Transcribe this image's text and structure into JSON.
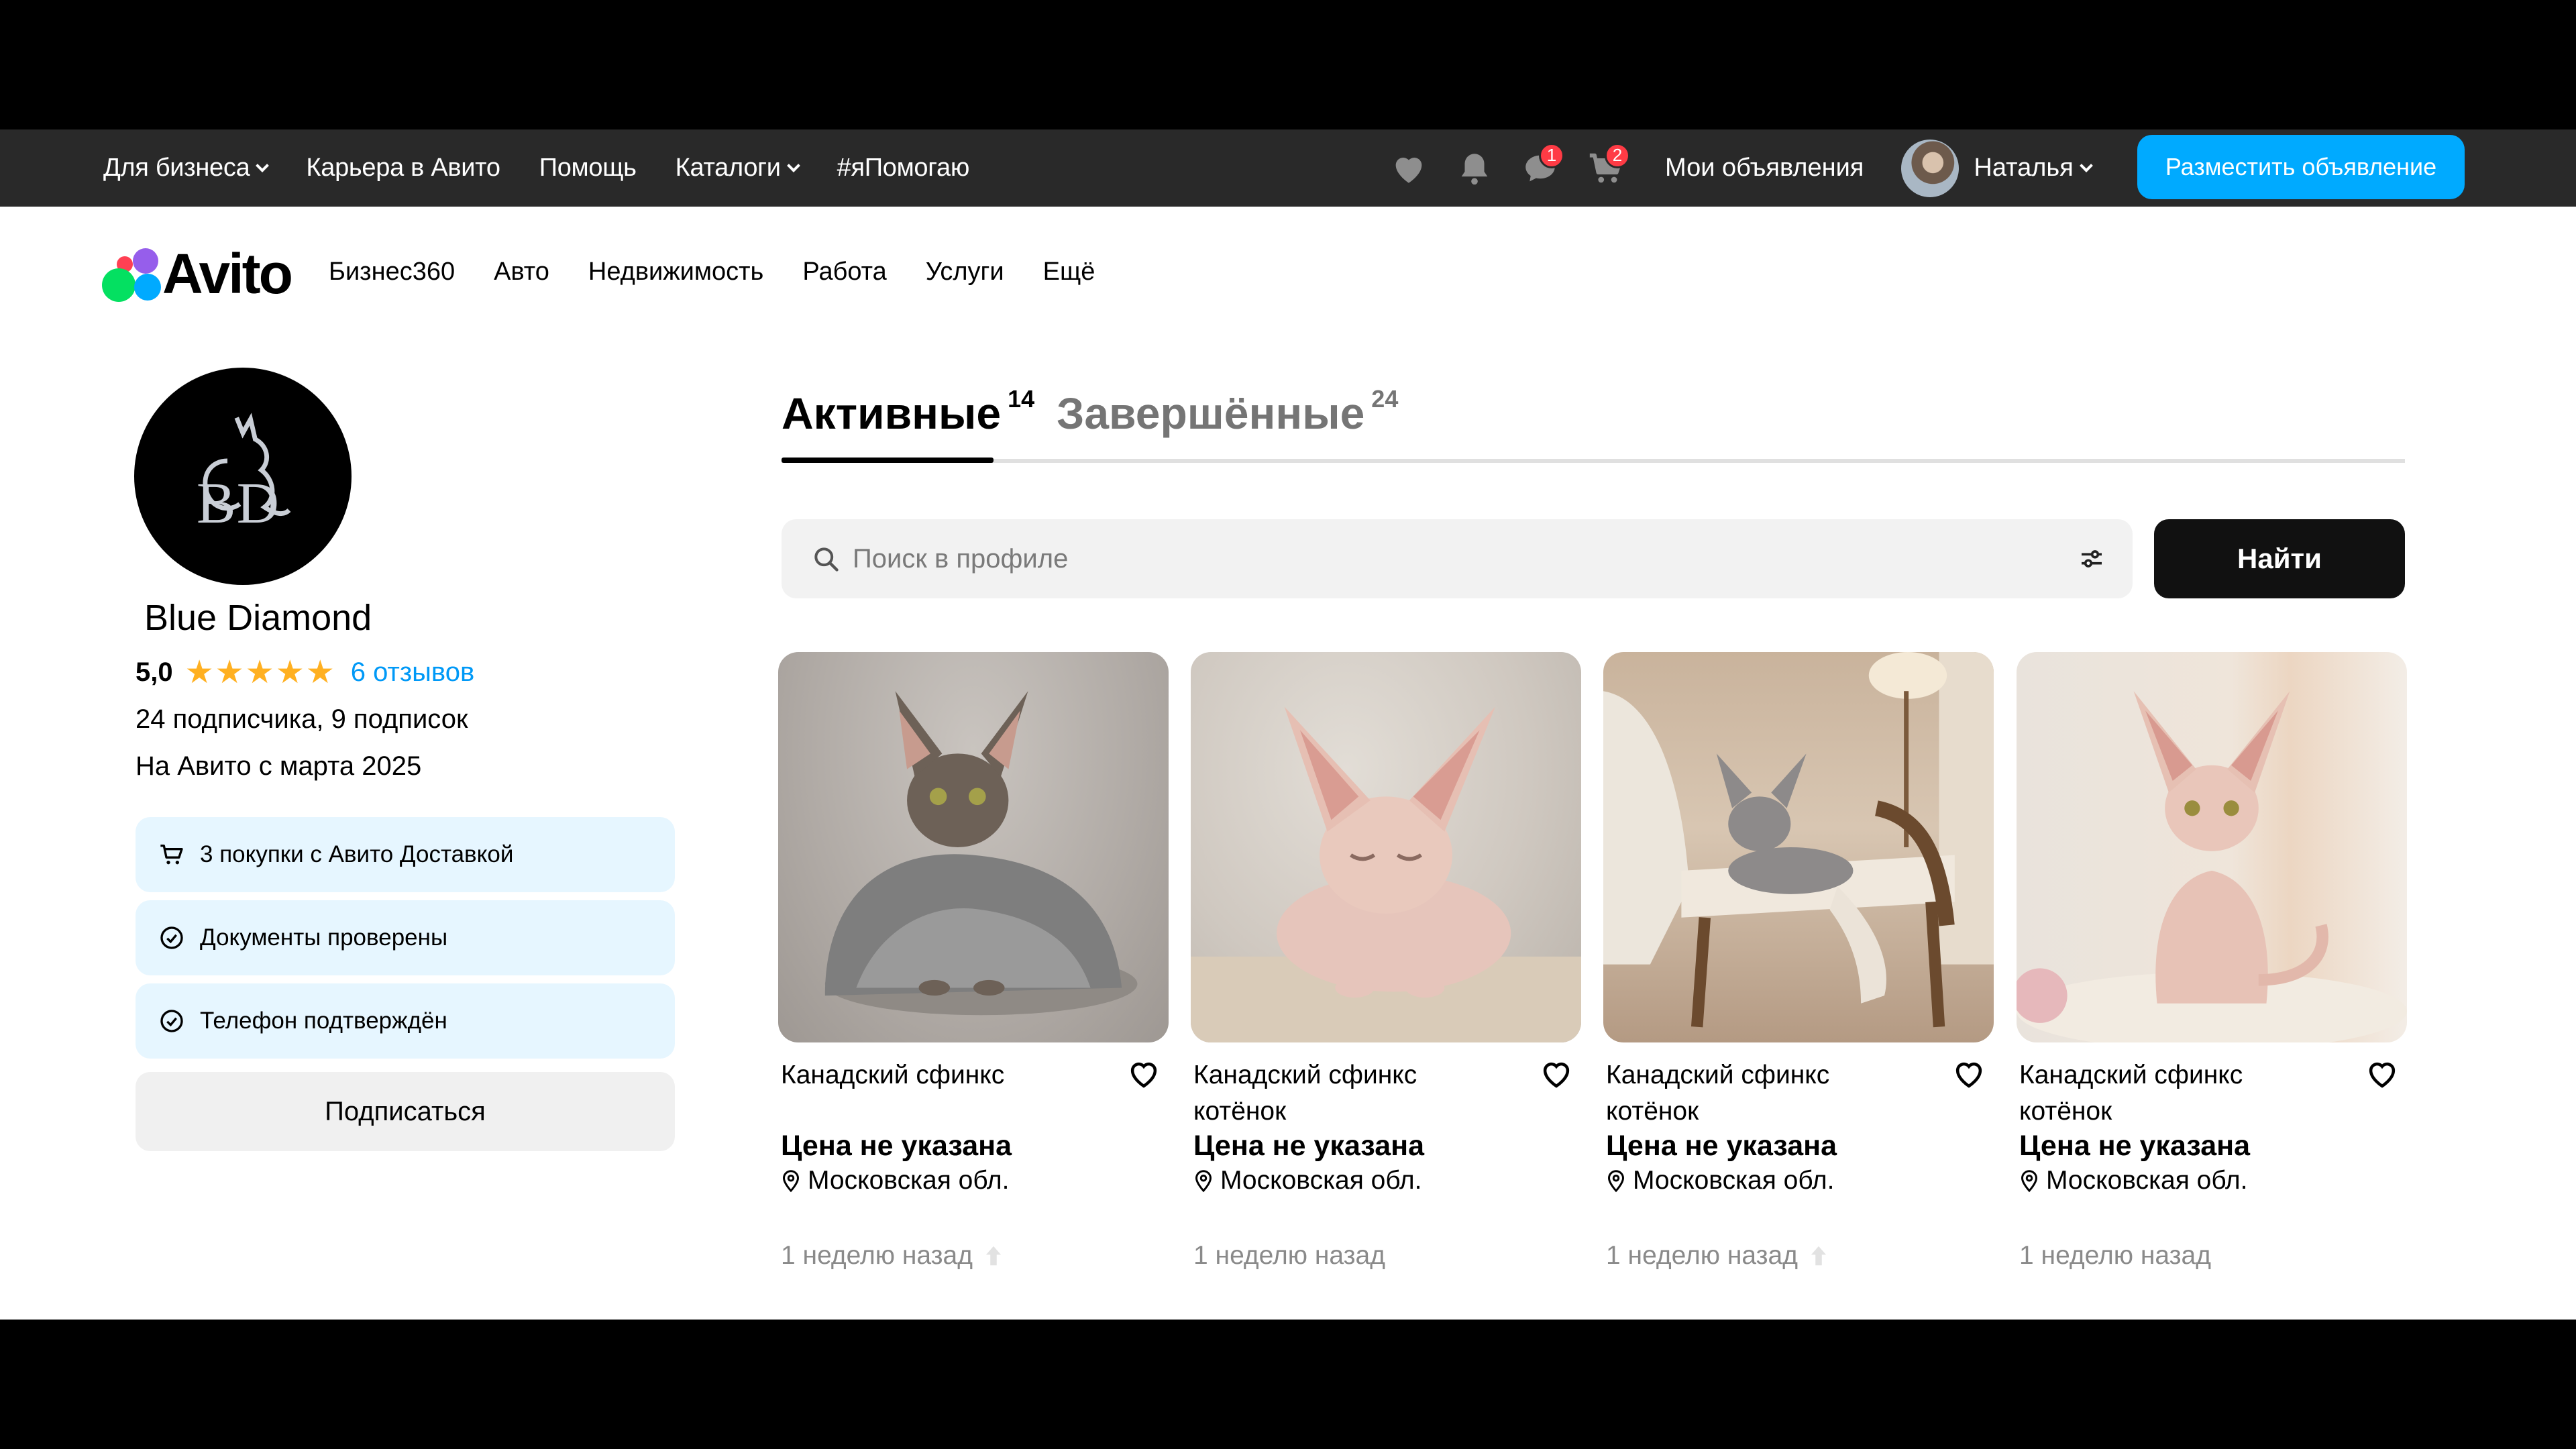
{
  "topbar": {
    "nav": [
      {
        "label": "Для бизнеса",
        "has_dropdown": true
      },
      {
        "label": "Карьера в Авито",
        "has_dropdown": false
      },
      {
        "label": "Помощь",
        "has_dropdown": false
      },
      {
        "label": "Каталоги",
        "has_dropdown": true
      },
      {
        "label": "#яПомогаю",
        "has_dropdown": false
      }
    ],
    "icons": {
      "favorites": "heart-icon",
      "notifications": "bell-icon",
      "messages": "chat-icon",
      "cart": "cart-icon"
    },
    "messages_badge": "1",
    "cart_badge": "2",
    "my_ads_label": "Мои объявления",
    "user_name": "Наталья",
    "post_ad_label": "Разместить объявление",
    "accent_color": "#00aaff",
    "badge_color": "#ff3b45"
  },
  "header": {
    "logo_text": "Avito",
    "categories": [
      "Бизнес360",
      "Авто",
      "Недвижимость",
      "Работа",
      "Услуги",
      "Ещё"
    ]
  },
  "profile": {
    "name": "Blue Diamond",
    "rating": "5,0",
    "stars": "★★★★★",
    "reviews_label": "6 отзывов",
    "subscribers_text": "24 подписчика, 9 подписок",
    "since_text": "На Авито с марта 2025",
    "badges": [
      {
        "icon": "cart-icon",
        "label": "3 покупки с Авито Доставкой"
      },
      {
        "icon": "check-circle-icon",
        "label": "Документы проверены"
      },
      {
        "icon": "check-circle-icon",
        "label": "Телефон подтверждён"
      }
    ],
    "subscribe_label": "Подписаться"
  },
  "tabs": {
    "active": {
      "label": "Активные",
      "count": "14"
    },
    "finished": {
      "label": "Завершённые",
      "count": "24"
    }
  },
  "search": {
    "placeholder": "Поиск в профиле",
    "button_label": "Найти"
  },
  "listings": [
    {
      "title": "Канадский сфинкс",
      "price": "Цена не указана",
      "location": "Московская обл.",
      "date": "1 неделю назад",
      "raised": true
    },
    {
      "title": "Канадский сфинкс котёнок",
      "price": "Цена не указана",
      "location": "Московская обл.",
      "date": "1 неделю назад",
      "raised": false
    },
    {
      "title": "Канадский сфинкс котёнок",
      "price": "Цена не указана",
      "location": "Московская обл.",
      "date": "1 неделю назад",
      "raised": true
    },
    {
      "title": "Канадский сфинкс котёнок",
      "price": "Цена не указана",
      "location": "Московская обл.",
      "date": "1 неделю назад",
      "raised": false
    }
  ]
}
